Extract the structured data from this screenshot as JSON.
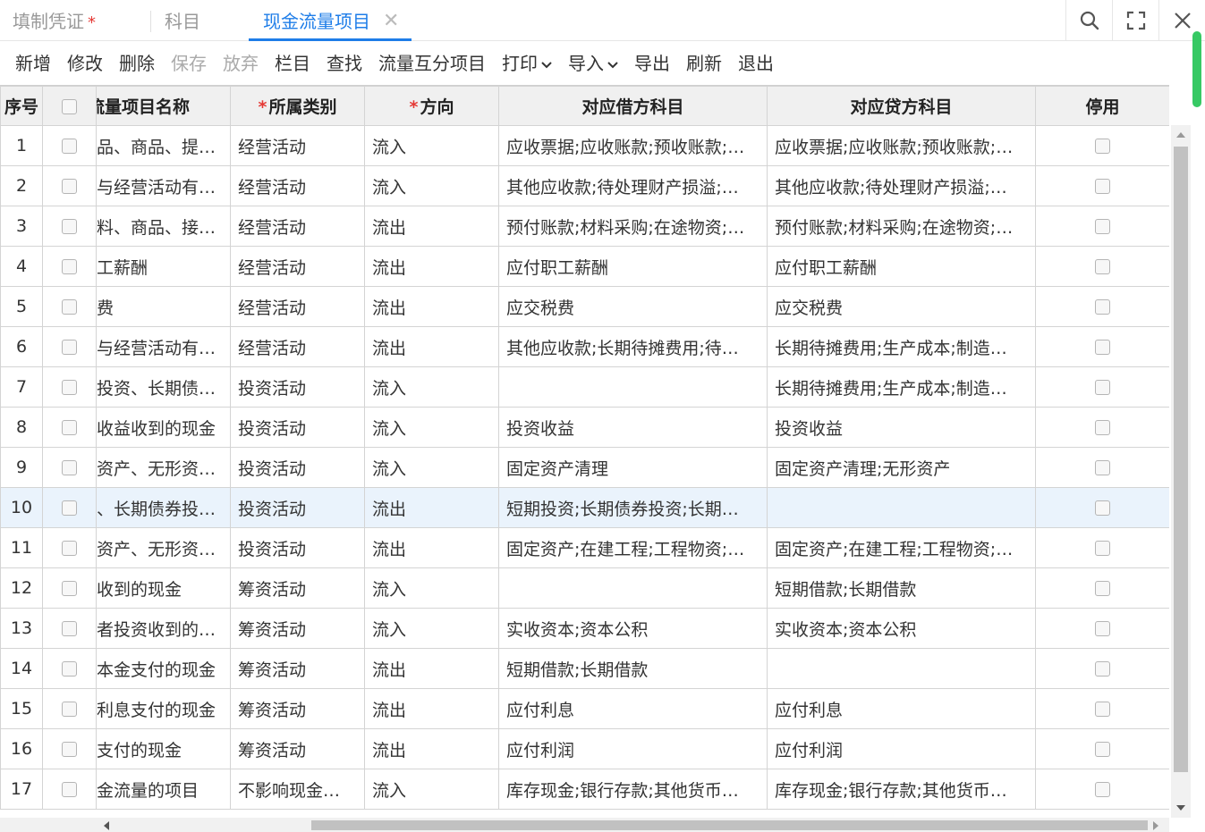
{
  "tabs": [
    {
      "label": "填制凭证",
      "modified": "*"
    },
    {
      "label": "科目"
    },
    {
      "label": "现金流量项目",
      "close": "✕"
    }
  ],
  "toolbar": [
    {
      "label": "新增",
      "enabled": true
    },
    {
      "label": "修改",
      "enabled": true
    },
    {
      "label": "删除",
      "enabled": true
    },
    {
      "label": "保存",
      "enabled": false
    },
    {
      "label": "放弃",
      "enabled": false
    },
    {
      "label": "栏目",
      "enabled": true
    },
    {
      "label": "查找",
      "enabled": true
    },
    {
      "label": "流量互分项目",
      "enabled": true
    },
    {
      "label": "打印",
      "enabled": true,
      "dropdown": true
    },
    {
      "label": "导入",
      "enabled": true,
      "dropdown": true
    },
    {
      "label": "导出",
      "enabled": true
    },
    {
      "label": "刷新",
      "enabled": true
    },
    {
      "label": "退出",
      "enabled": true
    }
  ],
  "columns": {
    "seq": "序号",
    "name": "流量项目名称",
    "category": "所属类别",
    "direction": "方向",
    "debit": "对应借方科目",
    "credit": "对应贷方科目",
    "disabled": "停用",
    "required_mark": "*"
  },
  "rows": [
    {
      "seq": "1",
      "name": "品、商品、提…",
      "category": "经营活动",
      "direction": "流入",
      "debit": "应收票据;应收账款;预收账款;…",
      "credit": "应收票据;应收账款;预收账款;…"
    },
    {
      "seq": "2",
      "name": "与经营活动有…",
      "category": "经营活动",
      "direction": "流入",
      "debit": "其他应收款;待处理财产损溢;…",
      "credit": "其他应收款;待处理财产损溢;…"
    },
    {
      "seq": "3",
      "name": "料、商品、接…",
      "category": "经营活动",
      "direction": "流出",
      "debit": "预付账款;材料采购;在途物资;…",
      "credit": "预付账款;材料采购;在途物资;…"
    },
    {
      "seq": "4",
      "name": "工薪酬",
      "category": "经营活动",
      "direction": "流出",
      "debit": "应付职工薪酬",
      "credit": "应付职工薪酬"
    },
    {
      "seq": "5",
      "name": "费",
      "category": "经营活动",
      "direction": "流出",
      "debit": "应交税费",
      "credit": "应交税费"
    },
    {
      "seq": "6",
      "name": "与经营活动有…",
      "category": "经营活动",
      "direction": "流出",
      "debit": "其他应收款;长期待摊费用;待…",
      "credit": "长期待摊费用;生产成本;制造…"
    },
    {
      "seq": "7",
      "name": "投资、长期债…",
      "category": "投资活动",
      "direction": "流入",
      "debit": "",
      "credit": "长期待摊费用;生产成本;制造…"
    },
    {
      "seq": "8",
      "name": "收益收到的现金",
      "category": "投资活动",
      "direction": "流入",
      "debit": "投资收益",
      "credit": "投资收益"
    },
    {
      "seq": "9",
      "name": "资产、无形资…",
      "category": "投资活动",
      "direction": "流入",
      "debit": "固定资产清理",
      "credit": "固定资产清理;无形资产"
    },
    {
      "seq": "10",
      "name": "、长期债券投…",
      "category": "投资活动",
      "direction": "流出",
      "debit": "短期投资;长期债券投资;长期…",
      "credit": ""
    },
    {
      "seq": "11",
      "name": "资产、无形资…",
      "category": "投资活动",
      "direction": "流出",
      "debit": "固定资产;在建工程;工程物资;…",
      "credit": "固定资产;在建工程;工程物资;…"
    },
    {
      "seq": "12",
      "name": "收到的现金",
      "category": "筹资活动",
      "direction": "流入",
      "debit": "",
      "credit": "短期借款;长期借款"
    },
    {
      "seq": "13",
      "name": "者投资收到的…",
      "category": "筹资活动",
      "direction": "流入",
      "debit": "实收资本;资本公积",
      "credit": "实收资本;资本公积"
    },
    {
      "seq": "14",
      "name": "本金支付的现金",
      "category": "筹资活动",
      "direction": "流出",
      "debit": "短期借款;长期借款",
      "credit": ""
    },
    {
      "seq": "15",
      "name": "利息支付的现金",
      "category": "筹资活动",
      "direction": "流出",
      "debit": "应付利息",
      "credit": "应付利息"
    },
    {
      "seq": "16",
      "name": "支付的现金",
      "category": "筹资活动",
      "direction": "流出",
      "debit": "应付利润",
      "credit": "应付利润"
    },
    {
      "seq": "17",
      "name": "金流量的项目",
      "category": "不影响现金…",
      "direction": "流入",
      "debit": "库存现金;银行存款;其他货币…",
      "credit": "库存现金;银行存款;其他货币…"
    }
  ],
  "selected_row": "10",
  "colors": {
    "accent": "#1e7de8",
    "required": "#e53935",
    "selected_row": "#eaf3fc",
    "scroll_indicator": "#37c964"
  }
}
